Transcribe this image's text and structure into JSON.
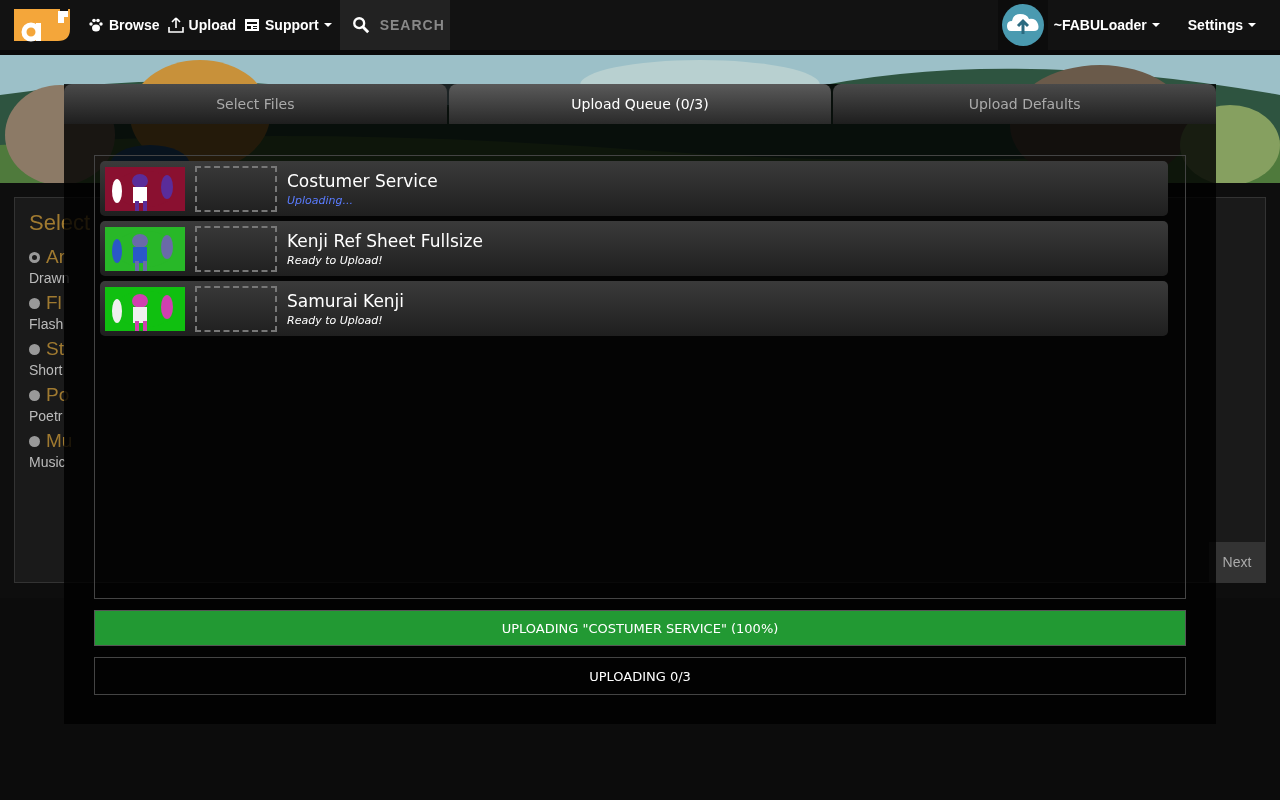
{
  "navbar": {
    "items": [
      {
        "label": "Browse",
        "kind": "link"
      },
      {
        "label": "Upload",
        "kind": "link"
      },
      {
        "label": "Support",
        "kind": "dropdown"
      }
    ],
    "search": {
      "placeholder": "SEARCH"
    },
    "user": {
      "name": "~FABULoader"
    },
    "settings": {
      "label": "Settings"
    }
  },
  "page": {
    "heading": "Select",
    "options": [
      {
        "label": "Ar",
        "description": "Drawn",
        "selected": true
      },
      {
        "label": "Fl",
        "description": "Flash",
        "selected": false
      },
      {
        "label": "St",
        "description": "Short",
        "selected": false
      },
      {
        "label": "Po",
        "description": "Poetr",
        "selected": false
      },
      {
        "label": "Mu",
        "description": "Music",
        "selected": false
      }
    ],
    "next_button": "Next"
  },
  "modal": {
    "tabs": [
      {
        "label": "Select Files",
        "selected": false
      },
      {
        "label": "Upload Queue (0/3)",
        "selected": true
      },
      {
        "label": "Upload Defaults",
        "selected": false
      }
    ],
    "queue": [
      {
        "title": "Costumer Service",
        "status": "Uploading...",
        "kind": "uploading"
      },
      {
        "title": "Kenji Ref Sheet Fullsize",
        "status": "Ready to Upload!",
        "kind": "ready"
      },
      {
        "title": "Samurai Kenji",
        "status": "Ready to Upload!",
        "kind": "ready"
      }
    ],
    "progress": {
      "label": "UPLOADING \"COSTUMER SERVICE\" (100%)",
      "level": 1
    },
    "summary": "UPLOADING 0/3"
  }
}
